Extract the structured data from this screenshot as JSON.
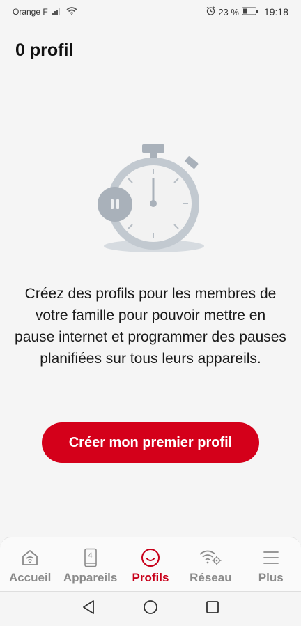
{
  "status_bar": {
    "carrier": "Orange F",
    "battery_percent": "23 %",
    "time": "19:18"
  },
  "header": {
    "title": "0 profil"
  },
  "illustration": {
    "icon": "paused-stopwatch-icon"
  },
  "main": {
    "description": "Créez des profils pour les membres de votre famille pour pouvoir mettre en pause internet et programmer des pauses planifiées sur tous leurs appareils.",
    "cta_label": "Créer mon premier profil"
  },
  "bottom_nav": {
    "items": [
      {
        "label": "Accueil",
        "icon": "home-wifi-icon",
        "active": false
      },
      {
        "label": "Appareils",
        "icon": "device-icon",
        "badge": "4",
        "active": false
      },
      {
        "label": "Profils",
        "icon": "profile-smile-icon",
        "active": true
      },
      {
        "label": "Réseau",
        "icon": "network-settings-icon",
        "active": false
      },
      {
        "label": "Plus",
        "icon": "menu-icon",
        "active": false
      }
    ]
  },
  "colors": {
    "accent": "#d4001a",
    "active_nav": "#c8001a",
    "inactive_nav": "#8a8a8a",
    "background": "#f5f5f5"
  }
}
